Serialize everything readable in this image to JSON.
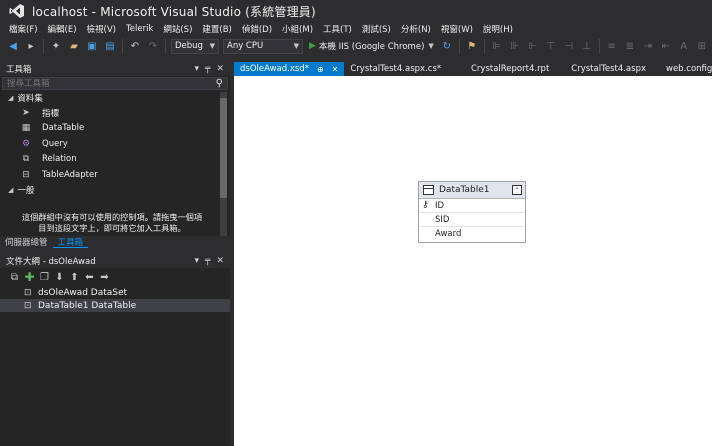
{
  "window": {
    "title": "localhost - Microsoft Visual Studio (系統管理員)"
  },
  "menu": [
    "檔案(F)",
    "編輯(E)",
    "檢視(V)",
    "Telerik",
    "網站(S)",
    "建置(B)",
    "偵錯(D)",
    "小組(M)",
    "工具(T)",
    "測試(S)",
    "分析(N)",
    "視窗(W)",
    "說明(H)"
  ],
  "toolbar": {
    "config": "Debug",
    "platform": "Any CPU",
    "run_label": "本機 IIS (Google Chrome)"
  },
  "toolbox": {
    "title": "工具箱",
    "search_placeholder": "搜尋工具箱",
    "group1": "資料集",
    "items": [
      "指標",
      "DataTable",
      "Query",
      "Relation",
      "TableAdapter"
    ],
    "group2": "一般",
    "empty_msg_line1": "這個群組中沒有可以使用的控制項。請拖曳一個項",
    "empty_msg_line2": "目到這段文字上，即可將它加入工具箱。"
  },
  "left_tabs": [
    "伺服器總管",
    "工具箱"
  ],
  "outline": {
    "title": "文件大綱 - dsOleAwad",
    "items": [
      "dsOleAwad  DataSet",
      "DataTable1  DataTable"
    ]
  },
  "doc_tabs": [
    "dsOleAwad.xsd*",
    "CrystalTest4.aspx.cs*",
    "CrystalReport4.rpt",
    "CrystalTest4.aspx",
    "web.config"
  ],
  "datatable": {
    "name": "DataTable1",
    "columns": [
      "ID",
      "SID",
      "Award"
    ]
  }
}
